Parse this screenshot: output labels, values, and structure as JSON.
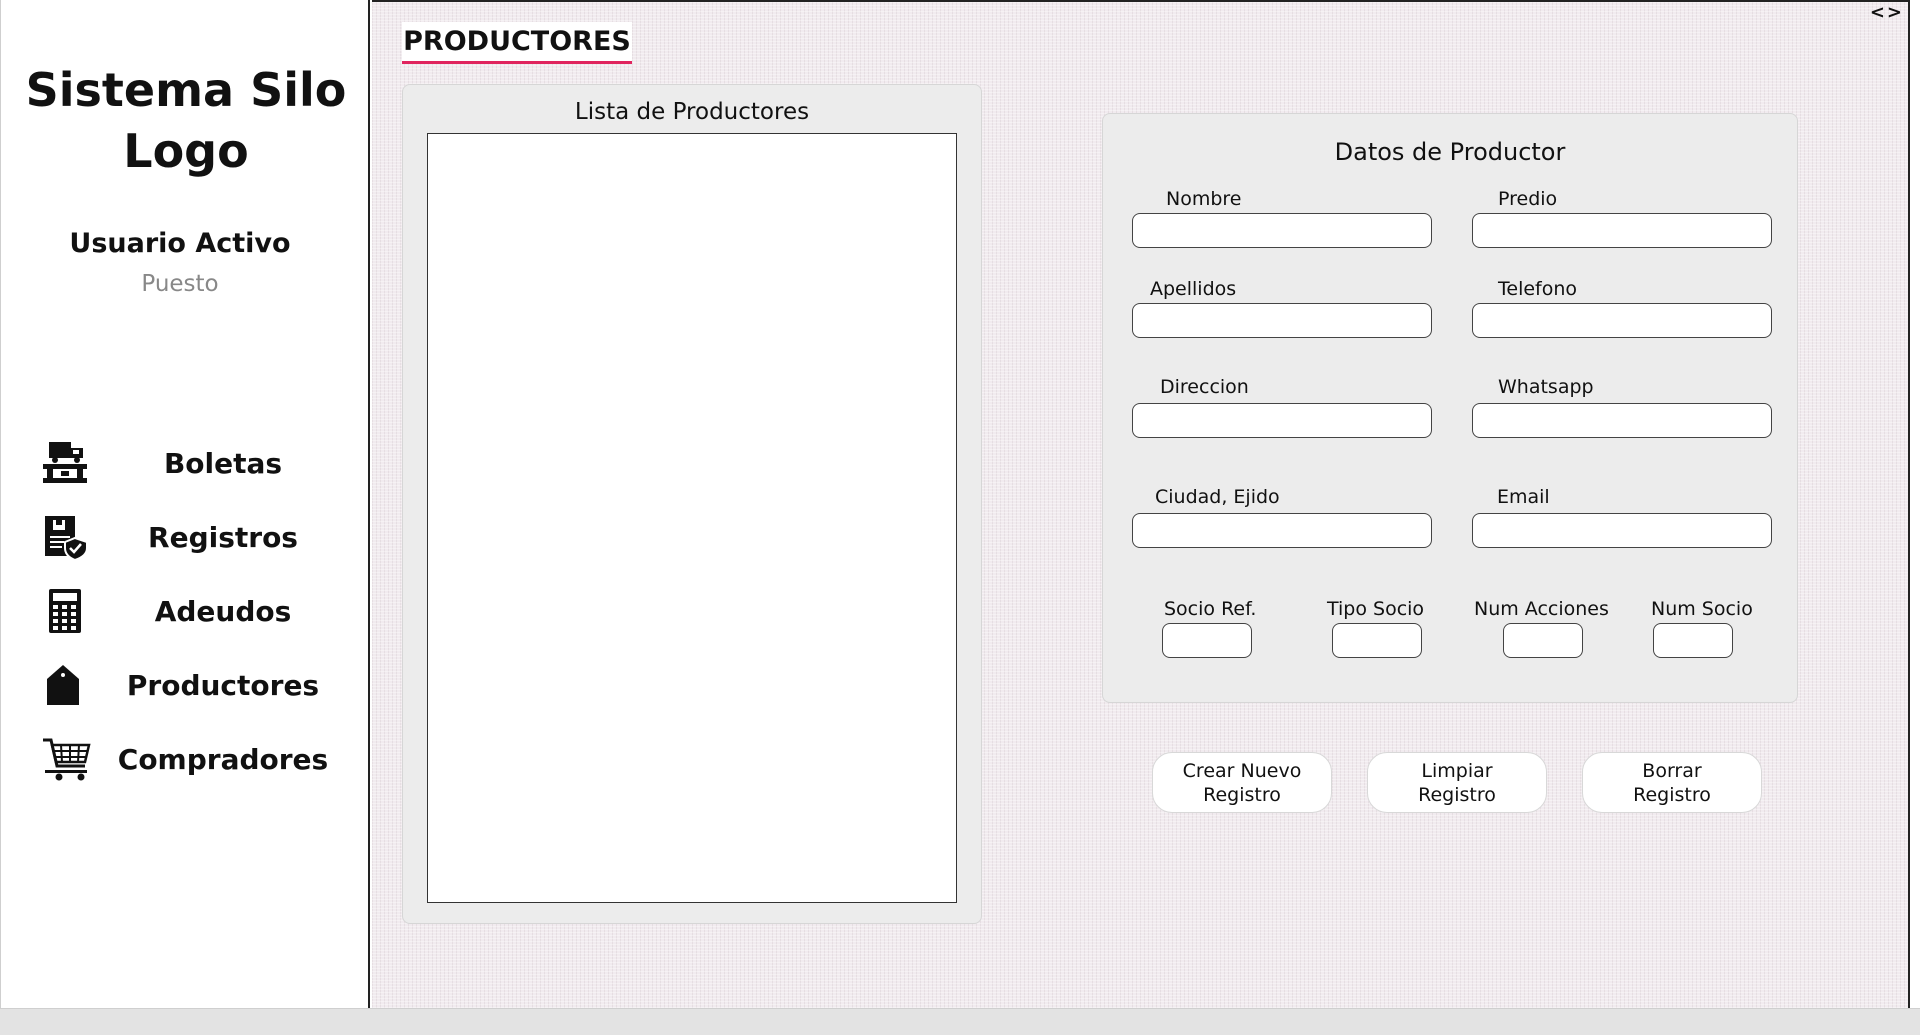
{
  "sidebar": {
    "title_line1": "Sistema Silo",
    "title_line2": "Logo",
    "user_name": "Usuario Activo",
    "user_role": "Puesto",
    "items": [
      {
        "label": "Boletas",
        "icon": "truck-scale-icon"
      },
      {
        "label": "Registros",
        "icon": "document-shield-icon"
      },
      {
        "label": "Adeudos",
        "icon": "calculator-icon"
      },
      {
        "label": "Productores",
        "icon": "house-tag-icon"
      },
      {
        "label": "Compradores",
        "icon": "shopping-cart-icon"
      }
    ]
  },
  "header": {
    "page_title": "PRODUCTORES",
    "nav_arrows": "<>"
  },
  "list_panel": {
    "title": "Lista de Productores"
  },
  "form": {
    "title": "Datos de Productor",
    "fields": {
      "nombre": {
        "label": "Nombre",
        "value": ""
      },
      "predio": {
        "label": "Predio",
        "value": ""
      },
      "apellidos": {
        "label": "Apellidos",
        "value": ""
      },
      "telefono": {
        "label": "Telefono",
        "value": ""
      },
      "direccion": {
        "label": "Direccion",
        "value": ""
      },
      "whatsapp": {
        "label": "Whatsapp",
        "value": ""
      },
      "ciudad": {
        "label": "Ciudad, Ejido",
        "value": ""
      },
      "email": {
        "label": "Email",
        "value": ""
      },
      "socio_ref": {
        "label": "Socio Ref.",
        "value": ""
      },
      "tipo_socio": {
        "label": "Tipo Socio",
        "value": ""
      },
      "num_acciones": {
        "label": "Num Acciones",
        "value": ""
      },
      "num_socio": {
        "label": "Num Socio",
        "value": ""
      }
    }
  },
  "buttons": {
    "create_line1": "Crear Nuevo",
    "create_line2": "Registro",
    "clear_line1": "Limpiar",
    "clear_line2": "Registro",
    "delete_line1": "Borrar",
    "delete_line2": "Registro"
  },
  "colors": {
    "accent": "#e0245e",
    "background": "#f1ebef",
    "panel": "#ececec"
  }
}
